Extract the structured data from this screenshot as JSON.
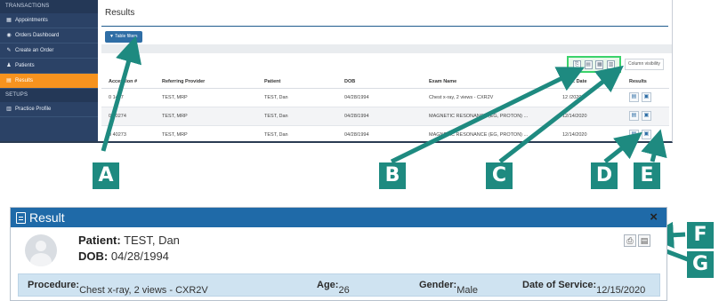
{
  "sidebar": {
    "sections": [
      {
        "header": "TRANSACTIONS",
        "items": [
          {
            "label": "Appointments",
            "icon": "calendar-icon",
            "active": false
          },
          {
            "label": "Orders Dashboard",
            "icon": "dashboard-icon",
            "active": false
          },
          {
            "label": "Create an Order",
            "icon": "edit-icon",
            "active": false
          },
          {
            "label": "Patients",
            "icon": "user-icon",
            "active": false
          },
          {
            "label": "Results",
            "icon": "results-icon",
            "active": true
          }
        ]
      },
      {
        "header": "SETUPS",
        "items": [
          {
            "label": "Practice Profile",
            "icon": "building-icon",
            "active": false
          }
        ]
      }
    ]
  },
  "main": {
    "title": "Results",
    "filter_button": "Table filters",
    "column_visibility": "Column visibility",
    "toolbar_icons": [
      "copy-icon",
      "csv-icon",
      "excel-icon",
      "pdf-icon"
    ],
    "table": {
      "columns": [
        "Accession #",
        "Referring Provider",
        "Patient",
        "DOB",
        "Exam Name",
        "Appt. Date",
        "Results"
      ],
      "rows": [
        [
          "0 1407",
          "TEST, MRP",
          "TEST, Dan",
          "04/28/1994",
          "Chest x-ray, 2 views - CXR2V",
          "12 /2020"
        ],
        [
          "0 40274",
          "TEST, MRP",
          "TEST, Dan",
          "04/28/1994",
          "MAGNETIC RESONANCE (EG, PROTON) ...",
          "12/14/2020"
        ],
        [
          "0 40273",
          "TEST, MRP",
          "TEST, Dan",
          "04/28/1994",
          "MAGNETIC RESONANCE (EG, PROTON) ...",
          "12/14/2020"
        ]
      ]
    }
  },
  "callouts": [
    "A",
    "B",
    "C",
    "D",
    "E",
    "F",
    "G"
  ],
  "dialog": {
    "title": "Result",
    "close": "×",
    "patient_label": "Patient:",
    "patient_value": "TEST, Dan",
    "dob_label": "DOB:",
    "dob_value": "04/28/1994",
    "procedure_label": "Procedure:",
    "procedure_value": "Chest x-ray, 2 views - CXR2V",
    "age_label": "Age:",
    "age_value": "26",
    "gender_label": "Gender:",
    "gender_value": "Male",
    "dos_label": "Date of Service:",
    "dos_value": "12/15/2020"
  },
  "colors": {
    "sidebar": "#2b4266",
    "active": "#f7931e",
    "accent": "#2f6ea6",
    "highlight": "#3bd36b",
    "callout": "#1e8a80",
    "arrow": "#1e8a80"
  }
}
